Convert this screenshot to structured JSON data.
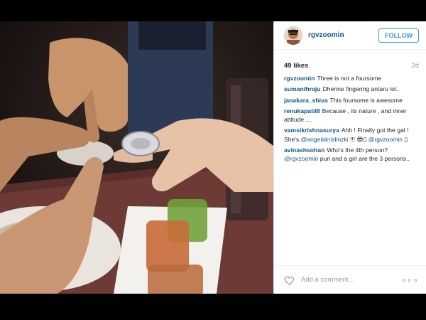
{
  "post": {
    "username": "rgvzoomin",
    "follow_label": "FOLLOW",
    "likes": "49 likes",
    "time": "2d",
    "add_comment_placeholder": "Add a comment...",
    "more_label": "∘∘∘"
  },
  "comments": [
    {
      "user": "rgvzoomin",
      "text": "Three is not a foursome"
    },
    {
      "user": "sumanthraju",
      "text": "Dhenne fingering antaru lol.."
    },
    {
      "user": "janakara_shiva",
      "text": "This foursome is awesome"
    },
    {
      "user": "renukapatil8",
      "text": "Because , its nature , and inner attitude ...."
    },
    {
      "user": "vamsikrishnasurya",
      "text_pre": "Ahh ! Finally got the gal ! She's ",
      "mention1": "@angelakrislinzki",
      "text_mid": " !!! 😎▯ ",
      "mention2": "@rgvzoomin",
      "text_post": " ▯"
    },
    {
      "user": "avinashsohan",
      "text_pre": "Who's the 4th person? ",
      "mention1": "@rgvzoomin",
      "text_post": " puri and a girl are the 3 persons.."
    }
  ],
  "icons": {
    "like": "heart-icon",
    "more": "more-options-icon"
  },
  "colors": {
    "link": "#125688",
    "follow": "#3897f0"
  }
}
